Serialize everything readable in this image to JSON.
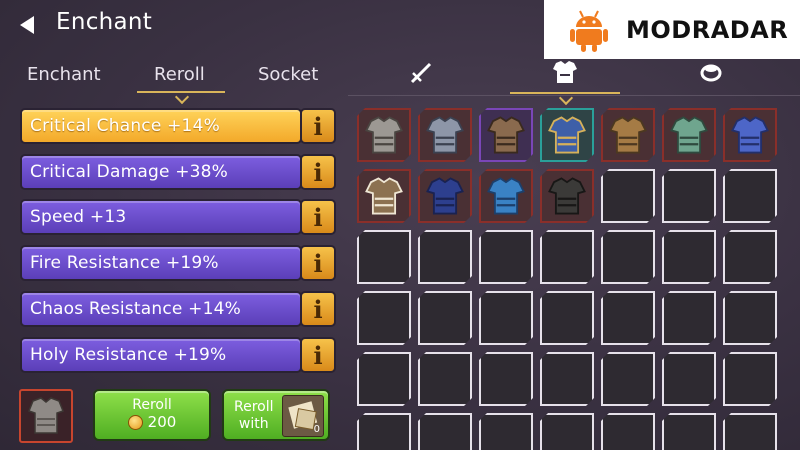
{
  "header": {
    "title": "Enchant",
    "back_icon": "back-arrow-icon"
  },
  "watermark": {
    "text": "MODRADAR",
    "logo": "android-robot-icon"
  },
  "tabs": [
    {
      "label": "Enchant",
      "active": false
    },
    {
      "label": "Reroll",
      "active": true
    },
    {
      "label": "Socket",
      "active": false
    }
  ],
  "categories": [
    {
      "icon": "sword-icon",
      "active": false
    },
    {
      "icon": "chest-armor-icon",
      "active": true
    },
    {
      "icon": "ring-icon",
      "active": false
    }
  ],
  "stats": [
    {
      "label": "Critical Chance +14%",
      "selected": true
    },
    {
      "label": "Critical Damage +38%",
      "selected": false
    },
    {
      "label": "Speed +13",
      "selected": false
    },
    {
      "label": "Fire Resistance +19%",
      "selected": false
    },
    {
      "label": "Chaos Resistance +14%",
      "selected": false
    },
    {
      "label": "Holy Resistance +19%",
      "selected": false
    }
  ],
  "info_label": "i",
  "actions": {
    "reroll_label": "Reroll",
    "reroll_cost": "200",
    "reroll_with_line1": "Reroll",
    "reroll_with_line2": "with",
    "scroll_count": "0"
  },
  "inventory": {
    "items": [
      {
        "icon": "steel-armor-icon",
        "frame": "red"
      },
      {
        "icon": "plate-armor-icon",
        "frame": "red"
      },
      {
        "icon": "leather-armor-icon",
        "frame": "purple"
      },
      {
        "icon": "blue-gold-armor-icon",
        "frame": "teal"
      },
      {
        "icon": "bronze-armor-icon",
        "frame": "red"
      },
      {
        "icon": "green-armor-icon",
        "frame": "red"
      },
      {
        "icon": "blue-plate-armor-icon",
        "frame": "red"
      },
      {
        "icon": "fur-coat-icon",
        "frame": "red"
      },
      {
        "icon": "blue-robe-icon",
        "frame": "red"
      },
      {
        "icon": "blue-cloak-icon",
        "frame": "red"
      },
      {
        "icon": "dark-vest-icon",
        "frame": "red"
      }
    ],
    "columns": 7,
    "rows": 6
  },
  "colors": {
    "selected_bar": "#f3a92a",
    "stat_bar": "#6a4ed0",
    "reroll_button": "#5fbf2a",
    "accent": "#d9b55a"
  }
}
